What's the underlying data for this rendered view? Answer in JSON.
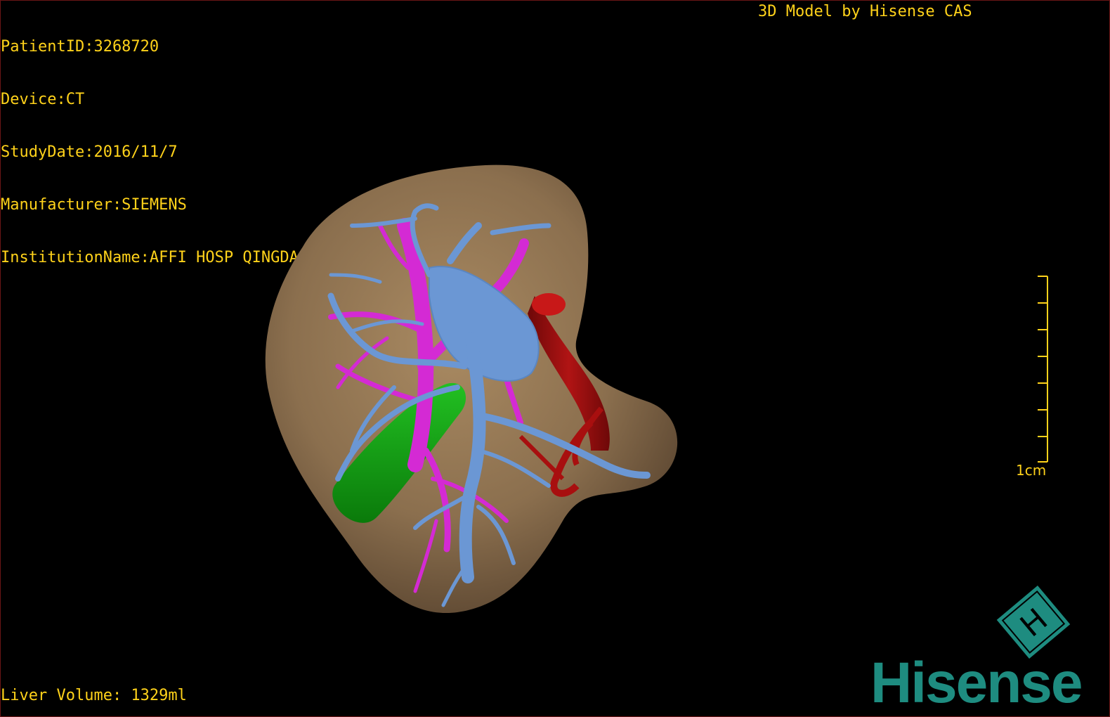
{
  "dicom": {
    "patient_id": "PatientID:3268720",
    "device": "Device:CT",
    "study_date": "StudyDate:2016/11/7",
    "manufacturer": "Manufacturer:SIEMENS",
    "institution": "InstitutionName:AFFI HOSP QINGDAO UNI"
  },
  "credit": "3D Model by Hisense CAS",
  "measurement": {
    "liver_volume": "Liver Volume: 1329ml"
  },
  "scale": {
    "label": "1cm"
  },
  "brand": {
    "name": "Hisense",
    "logo_glyph": "H"
  },
  "colors": {
    "overlay_text": "#ffd21a",
    "liver": "#8b6f4e",
    "portal_vein": "#6b97d4",
    "hepatic_vein": "#d42ad4",
    "artery": "#a80f0f",
    "gallbladder": "#11a311",
    "brand": "#1e8c80"
  }
}
